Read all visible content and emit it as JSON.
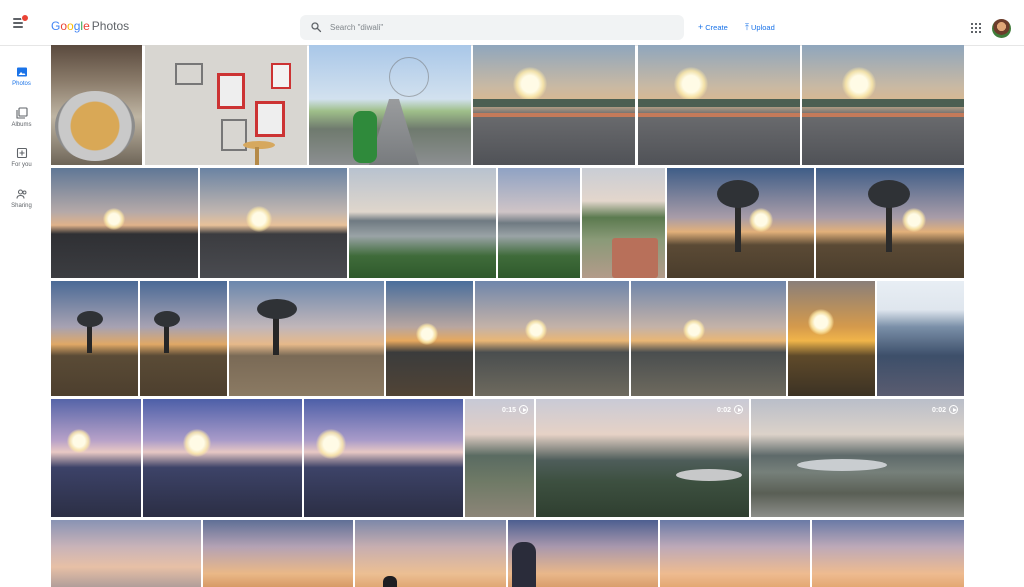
{
  "app": {
    "logo_google": "Google",
    "logo_photos": "Photos"
  },
  "header": {
    "search_placeholder": "Search \"diwali\"",
    "create_label": "Create",
    "upload_label": "Upload"
  },
  "sidebar": {
    "items": [
      {
        "label": "Photos",
        "icon": "photo-icon",
        "active": true
      },
      {
        "label": "Albums",
        "icon": "albums-icon",
        "active": false
      },
      {
        "label": "For you",
        "icon": "for-you-icon",
        "active": false
      },
      {
        "label": "Sharing",
        "icon": "sharing-icon",
        "active": false
      }
    ]
  },
  "videos": {
    "v1": "0:15",
    "v2": "0:02",
    "v3": "0:02"
  },
  "colors": {
    "accent": "#1a73e8",
    "google_blue": "#4285f4",
    "google_red": "#ea4335",
    "google_yellow": "#fbbc05",
    "google_green": "#34a853"
  }
}
